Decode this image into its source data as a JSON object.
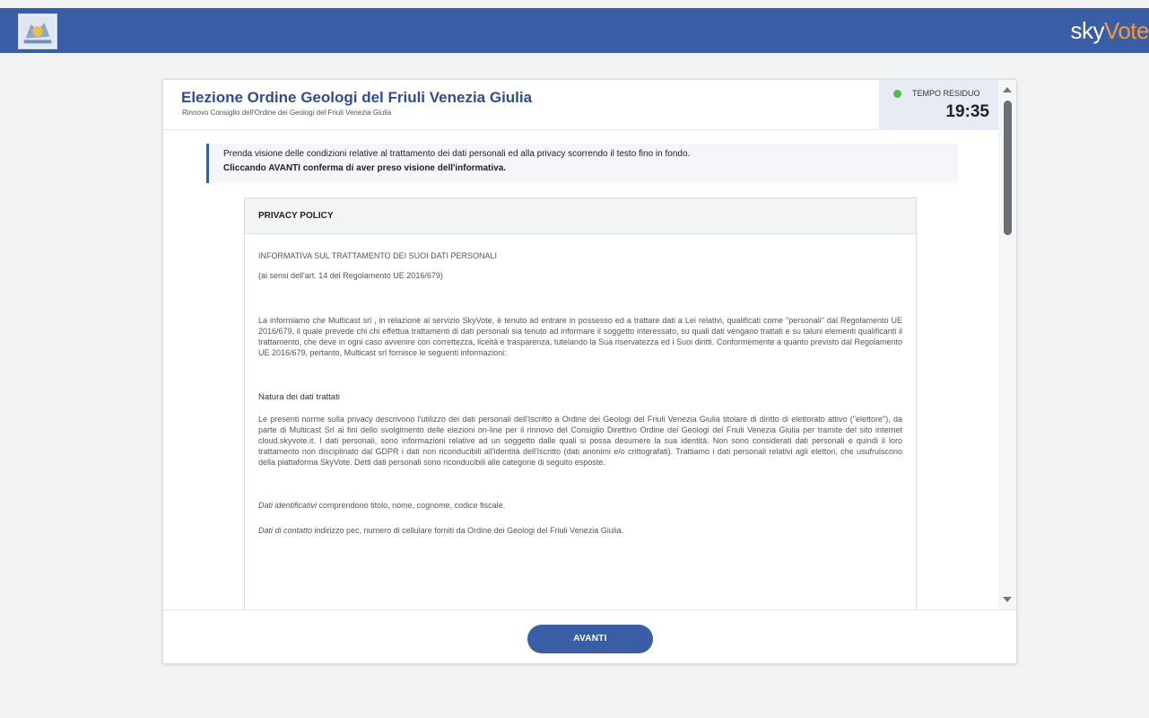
{
  "topbar": {
    "brand_part1": "sky",
    "brand_part2": "Vote",
    "brand_accent": "#f39a3c",
    "bar_color": "#3a5ea6",
    "logo_icon": "regional-emblem-icon"
  },
  "header": {
    "title": "Elezione Ordine Geologi del Friuli Venezia Giulia",
    "subtitle": "Rinnovo Consiglio dell'Ordine dei Geologi del Friuli Venezia Giulia"
  },
  "timer": {
    "label": "TEMPO RESIDUO",
    "value": "19:35",
    "status_color": "#5ab45e"
  },
  "notice": {
    "line1": "Prenda visione delle condizioni relative al trattamento dei dati personali ed alla privacy scorrendo il testo fino in fondo.",
    "line2": "Cliccando AVANTI conferma di aver preso visione dell'informativa."
  },
  "policy": {
    "heading": "PRIVACY POLICY",
    "doc_title": "INFORMATIVA SUL TRATTAMENTO DEI SUOI DATI PERSONALI",
    "doc_subtitle": "(ai sensi dell'art. 14 del Regolamento UE 2016/679)",
    "intro": "La informiamo che Multicast srl , in relazione al servizio SkyVote, è tenuto ad entrare in possesso ed a trattare dati a Lei relativi, qualificati come \"personali\" dal Regolamento UE 2016/679, il quale prevede chi chi effettua trattamenti di dati personali sia tenuto ad informare il soggetto interessato, su quali dati vengano trattati e su taluni elementi qualificanti il trattamento, che deve in ogni caso avvenire con correttezza, liceità e trasparenza, tutelando la Sua riservatezza ed i Suoi diritti. Conformemente a quanto previsto dal Regolamento UE 2016/679, pertanto, Multicast srl fornisce le seguenti informazioni:",
    "section_title": "Natura dei dati trattati",
    "section_text": "Le presenti norme sulla privacy descrivono l'utilizzo dei dati personali dell'Iscritto a Ordine dei Geologi del Friuli Venezia Giulia titolare di diritto di elettorato attivo (\"elettore\"), da parte di Multicast Srl ai fini dello svolgimento delle elezioni on-line per il rinnovo del Consiglio Direttivo Ordine dei Geologi del Friuli Venezia Giulia per tramite del sito internet cloud.skyvote.it. I dati personali, sono informazioni relative ad un soggetto dalle quali si possa desumere la sua identità. Non sono considerati dati personali e quindi il loro trattamento non disciplinato dal GDPR i dati non riconducibili all'identità dell'Iscritto (dati anonimi e/o crittografati). Trattiamo i dati personali relativi agli elettori, che usufruiscono della piattaforma SkyVote. Detti dati personali sono riconducibili alle categorie di seguito esposte.",
    "item1_label": "Dati identificativi",
    "item1_text": " comprendono titolo, nome, cognome, codice fiscale.",
    "item2_label": "Dati di contatto",
    "item2_text": " indirizzo pec, numero di cellulare forniti da Ordine dei Geologi del Friuli Venezia Giulia."
  },
  "footer": {
    "button_label": "AVANTI"
  }
}
